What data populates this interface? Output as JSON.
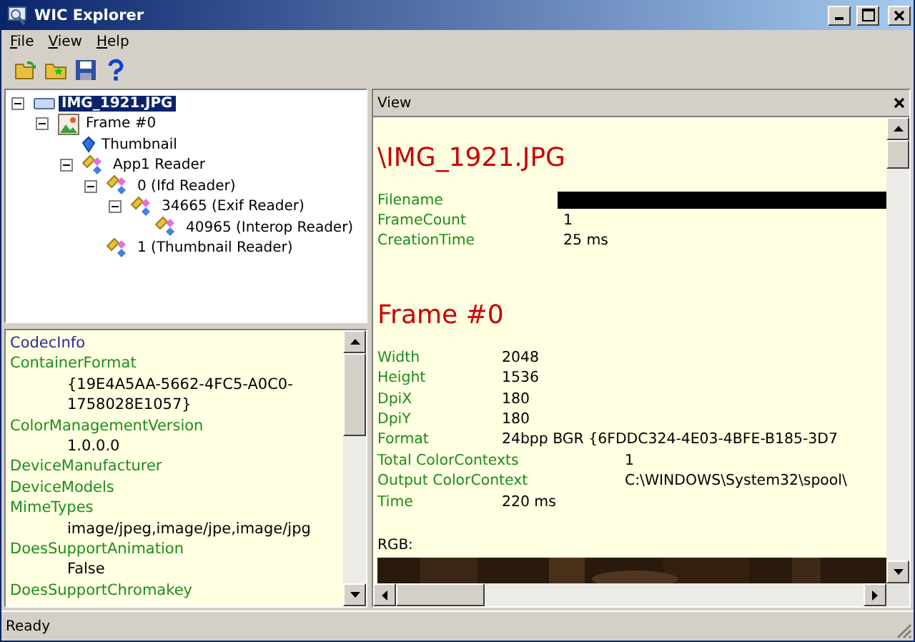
{
  "window": {
    "title": "WIC Explorer"
  },
  "menu": [
    {
      "label": "File"
    },
    {
      "label": "View"
    },
    {
      "label": "Help"
    }
  ],
  "toolbar": [
    {
      "kind": "open"
    },
    {
      "kind": "new"
    },
    {
      "kind": "save"
    },
    {
      "kind": "help"
    }
  ],
  "tree": [
    {
      "label": "IMG_1921.JPG",
      "kind": "file",
      "selected": true,
      "expanded": true,
      "children": [
        {
          "label": "Frame #0",
          "kind": "frame",
          "selected": false,
          "expanded": true,
          "children": [
            {
              "label": "Thumbnail",
              "kind": "thumbnail",
              "selected": false
            },
            {
              "label": "App1 Reader",
              "kind": "reader",
              "selected": false,
              "expanded": true,
              "children": [
                {
                  "label": "0 (Ifd Reader)",
                  "kind": "reader",
                  "selected": false,
                  "expanded": true,
                  "children": [
                    {
                      "label": "34665 (Exif Reader)",
                      "kind": "reader",
                      "selected": false,
                      "expanded": true,
                      "children": [
                        {
                          "label": "40965 (Interop Reader)",
                          "kind": "reader",
                          "selected": false
                        }
                      ]
                    }
                  ]
                },
                {
                  "label": "1 (Thumbnail Reader)",
                  "kind": "reader",
                  "selected": false
                }
              ]
            }
          ]
        }
      ]
    }
  ],
  "properties": [
    {
      "kind": "heading",
      "text": "CodecInfo"
    },
    {
      "kind": "name",
      "text": "ContainerFormat"
    },
    {
      "kind": "value",
      "text": "{19E4A5AA-5662-4FC5-A0C0-1758028E1057}"
    },
    {
      "kind": "name",
      "text": "ColorManagementVersion"
    },
    {
      "kind": "value",
      "text": "1.0.0.0"
    },
    {
      "kind": "name",
      "text": "DeviceManufacturer"
    },
    {
      "kind": "name",
      "text": "DeviceModels"
    },
    {
      "kind": "name",
      "text": "MimeTypes"
    },
    {
      "kind": "value",
      "text": "image/jpeg,image/jpe,image/jpg"
    },
    {
      "kind": "name",
      "text": "DoesSupportAnimation"
    },
    {
      "kind": "value",
      "text": "False"
    },
    {
      "kind": "name",
      "text": "DoesSupportChromakey"
    }
  ],
  "view": {
    "title": "View",
    "sections": [
      {
        "heading": "\\IMG_1921.JPG",
        "rows": [
          {
            "kind": "redacted",
            "name": "Filename"
          },
          {
            "kind": "file_field",
            "name": "FrameCount",
            "value": "1"
          },
          {
            "kind": "file_field",
            "name": "CreationTime",
            "value": "25 ms"
          }
        ]
      },
      {
        "heading": "Frame #0",
        "rows": [
          {
            "kind": "field",
            "name": "Width",
            "value": "2048"
          },
          {
            "kind": "field",
            "name": "Height",
            "value": "1536"
          },
          {
            "kind": "field",
            "name": "DpiX",
            "value": "180"
          },
          {
            "kind": "field",
            "name": "DpiY",
            "value": "180"
          },
          {
            "kind": "field",
            "name": "Format",
            "value": "24bpp BGR {6FDDC324-4E03-4BFE-B185-3D7"
          },
          {
            "kind": "long_field",
            "name": "Total ColorContexts",
            "value": "1"
          },
          {
            "kind": "long_field",
            "name": "Output ColorContext",
            "value": "C:\\WINDOWS\\System32\\spool\\"
          },
          {
            "kind": "field",
            "name": "Time",
            "value": "220 ms"
          }
        ]
      }
    ],
    "image_label": "RGB:"
  },
  "status_bar": {
    "text": "Ready"
  }
}
